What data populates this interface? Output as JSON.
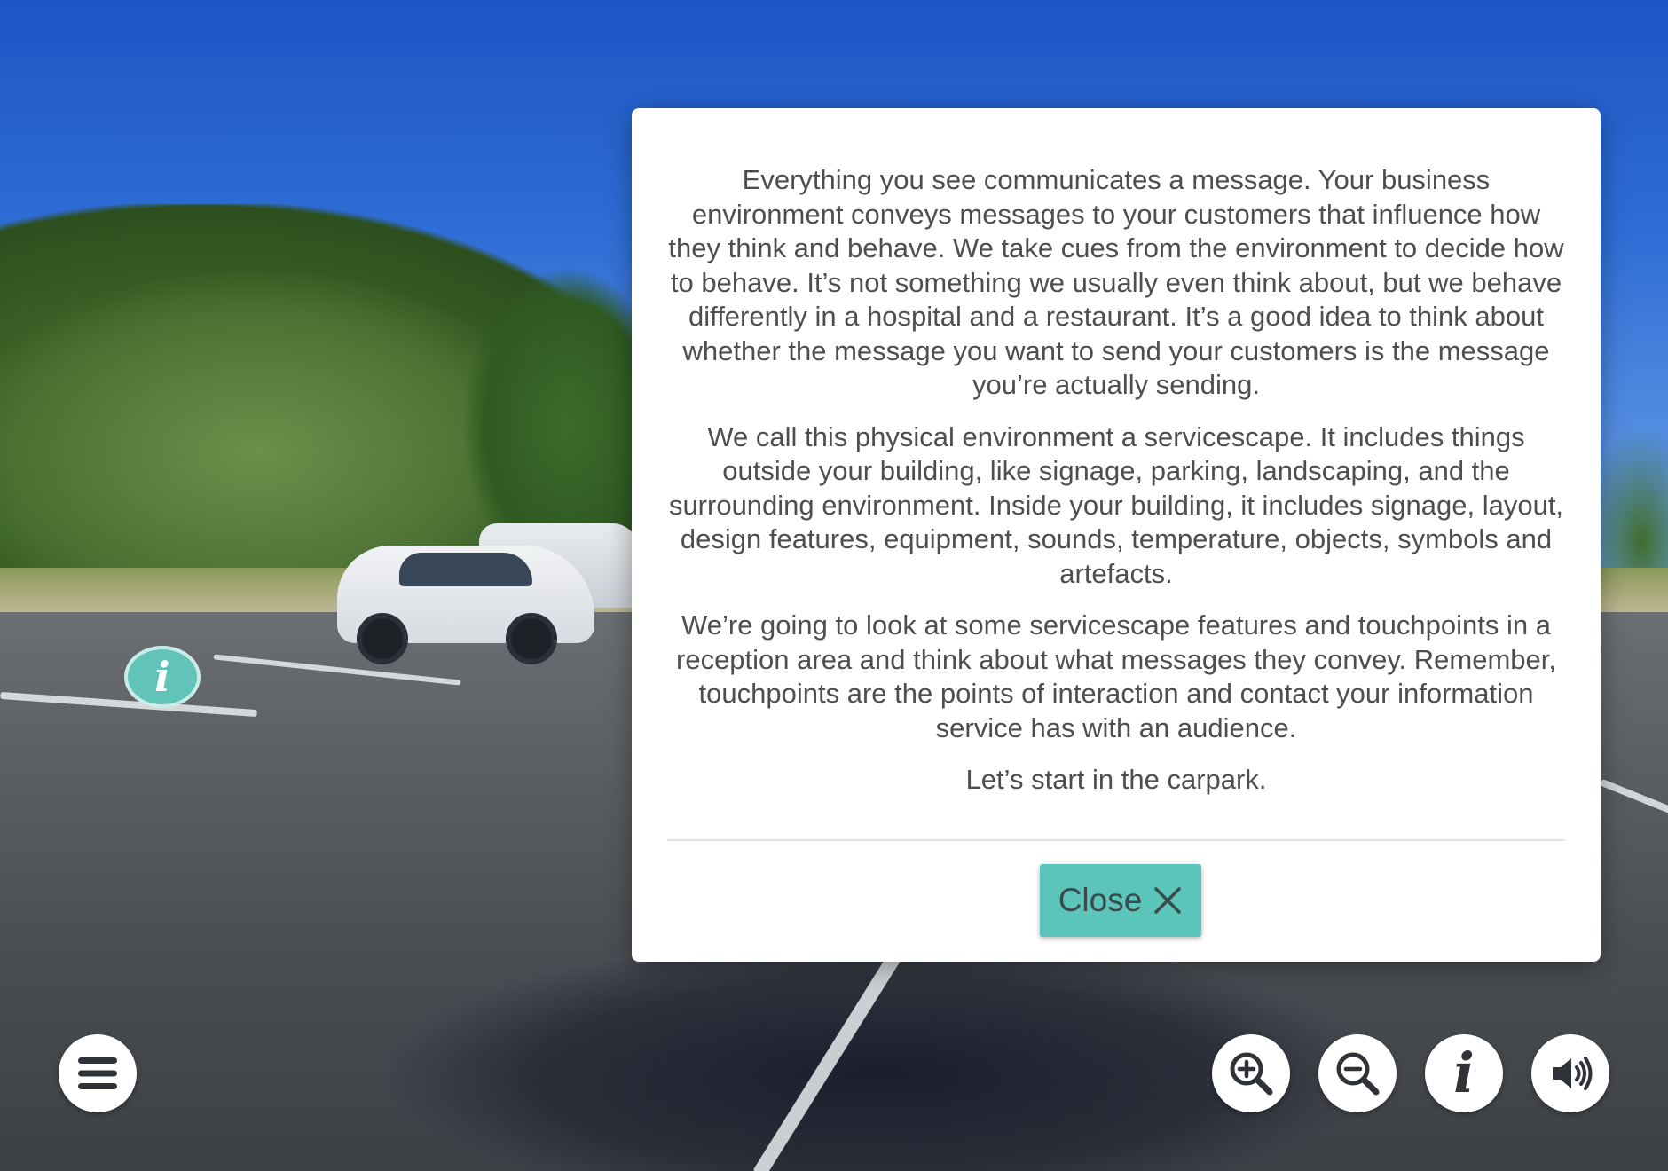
{
  "colors": {
    "accent": "#5cc5bb",
    "hotspot": "#62c4b9",
    "modal_text": "#4e4e4e",
    "icon": "#2f3338"
  },
  "hotspot": {
    "glyph": "i",
    "icon": "info-icon"
  },
  "modal": {
    "paragraphs": [
      "Everything you see communicates a message. Your business environment conveys messages to your customers that influence how they think and behave. We take cues from the environment to decide how to behave. It’s not something we usually even think about, but we behave differently in a hospital and a restaurant. It’s a good idea to think about whether the message you want to send your customers is the message you’re actually sending.",
      "We call this physical environment a servicescape. It includes things outside your building, like signage, parking, landscaping, and the surrounding environment. Inside your building, it includes signage, layout, design features, equipment, sounds, temperature, objects, symbols and artefacts.",
      "We’re going to look at some servicescape features and touchpoints in a reception area and think about what messages they convey. Remember, touchpoints are the points of interaction and contact your information service has with an audience.",
      "Let’s start in the carpark."
    ],
    "close_label": "Close",
    "close_icon": "close-icon"
  },
  "controls": {
    "menu_icon": "hamburger-menu-icon",
    "zoom_in_icon": "zoom-in-icon",
    "zoom_out_icon": "zoom-out-icon",
    "info_glyph": "i",
    "sound_icon": "speaker-icon"
  }
}
